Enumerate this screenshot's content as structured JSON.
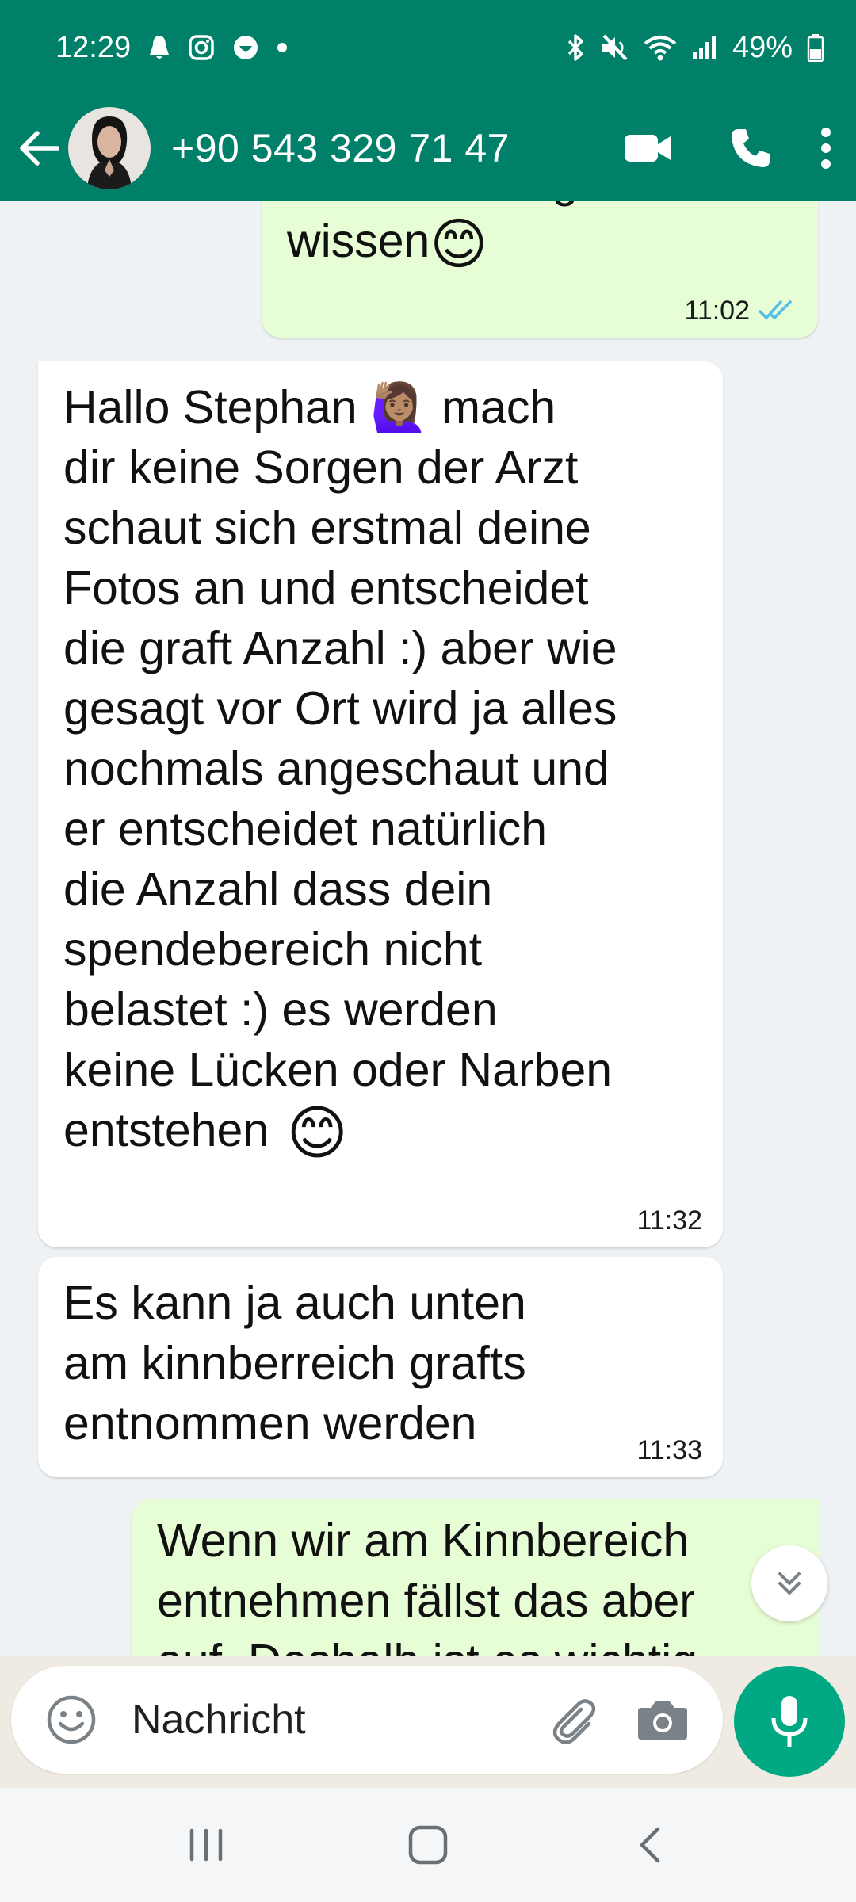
{
  "status_bar": {
    "time": "12:29",
    "battery": "49%",
    "icons": [
      "notification-icon",
      "instagram-icon",
      "app-icon",
      "dot-icon",
      "bluetooth-icon",
      "mute-icon",
      "wifi-icon",
      "signal-icon",
      "battery-icon"
    ]
  },
  "header": {
    "contact": "+90 543 329 71 47",
    "actions": [
      "video-call-icon",
      "voice-call-icon",
      "more-options-icon"
    ]
  },
  "messages": [
    {
      "direction": "out",
      "text": "das ist wichtig zu\nwissen",
      "emoji": "😊",
      "time": "11:02",
      "status": "read"
    },
    {
      "direction": "in",
      "text": "Hallo Stephan 🙋🏽‍♀️ mach\ndir keine Sorgen der Arzt\nschaut sich erstmal deine\nFotos an und entscheidet\ndie graft Anzahl :) aber wie\ngesagt vor Ort wird ja alles\nnochmals angeschaut und\ner entscheidet natürlich\ndie Anzahl dass dein\nspendebereich nicht\nbelastet :) es werden\nkeine Lücken oder Narben\nentstehen",
      "emoji": "😊",
      "time": "11:32"
    },
    {
      "direction": "in",
      "text": "Es kann ja auch unten\nam kinnberreich grafts\nentnommen werden",
      "time": "11:33"
    },
    {
      "direction": "out",
      "text": "Wenn wir am Kinnbereich\nentnehmen fällst das aber\nauf. Deshalb ist es wichtig"
    }
  ],
  "composer": {
    "placeholder": "Nachricht"
  },
  "colors": {
    "header": "#008069",
    "outgoing_bubble": "#e7fdd6",
    "incoming_bubble": "#ffffff",
    "mic_button": "#00a884",
    "read_ticks": "#53bdeb"
  }
}
